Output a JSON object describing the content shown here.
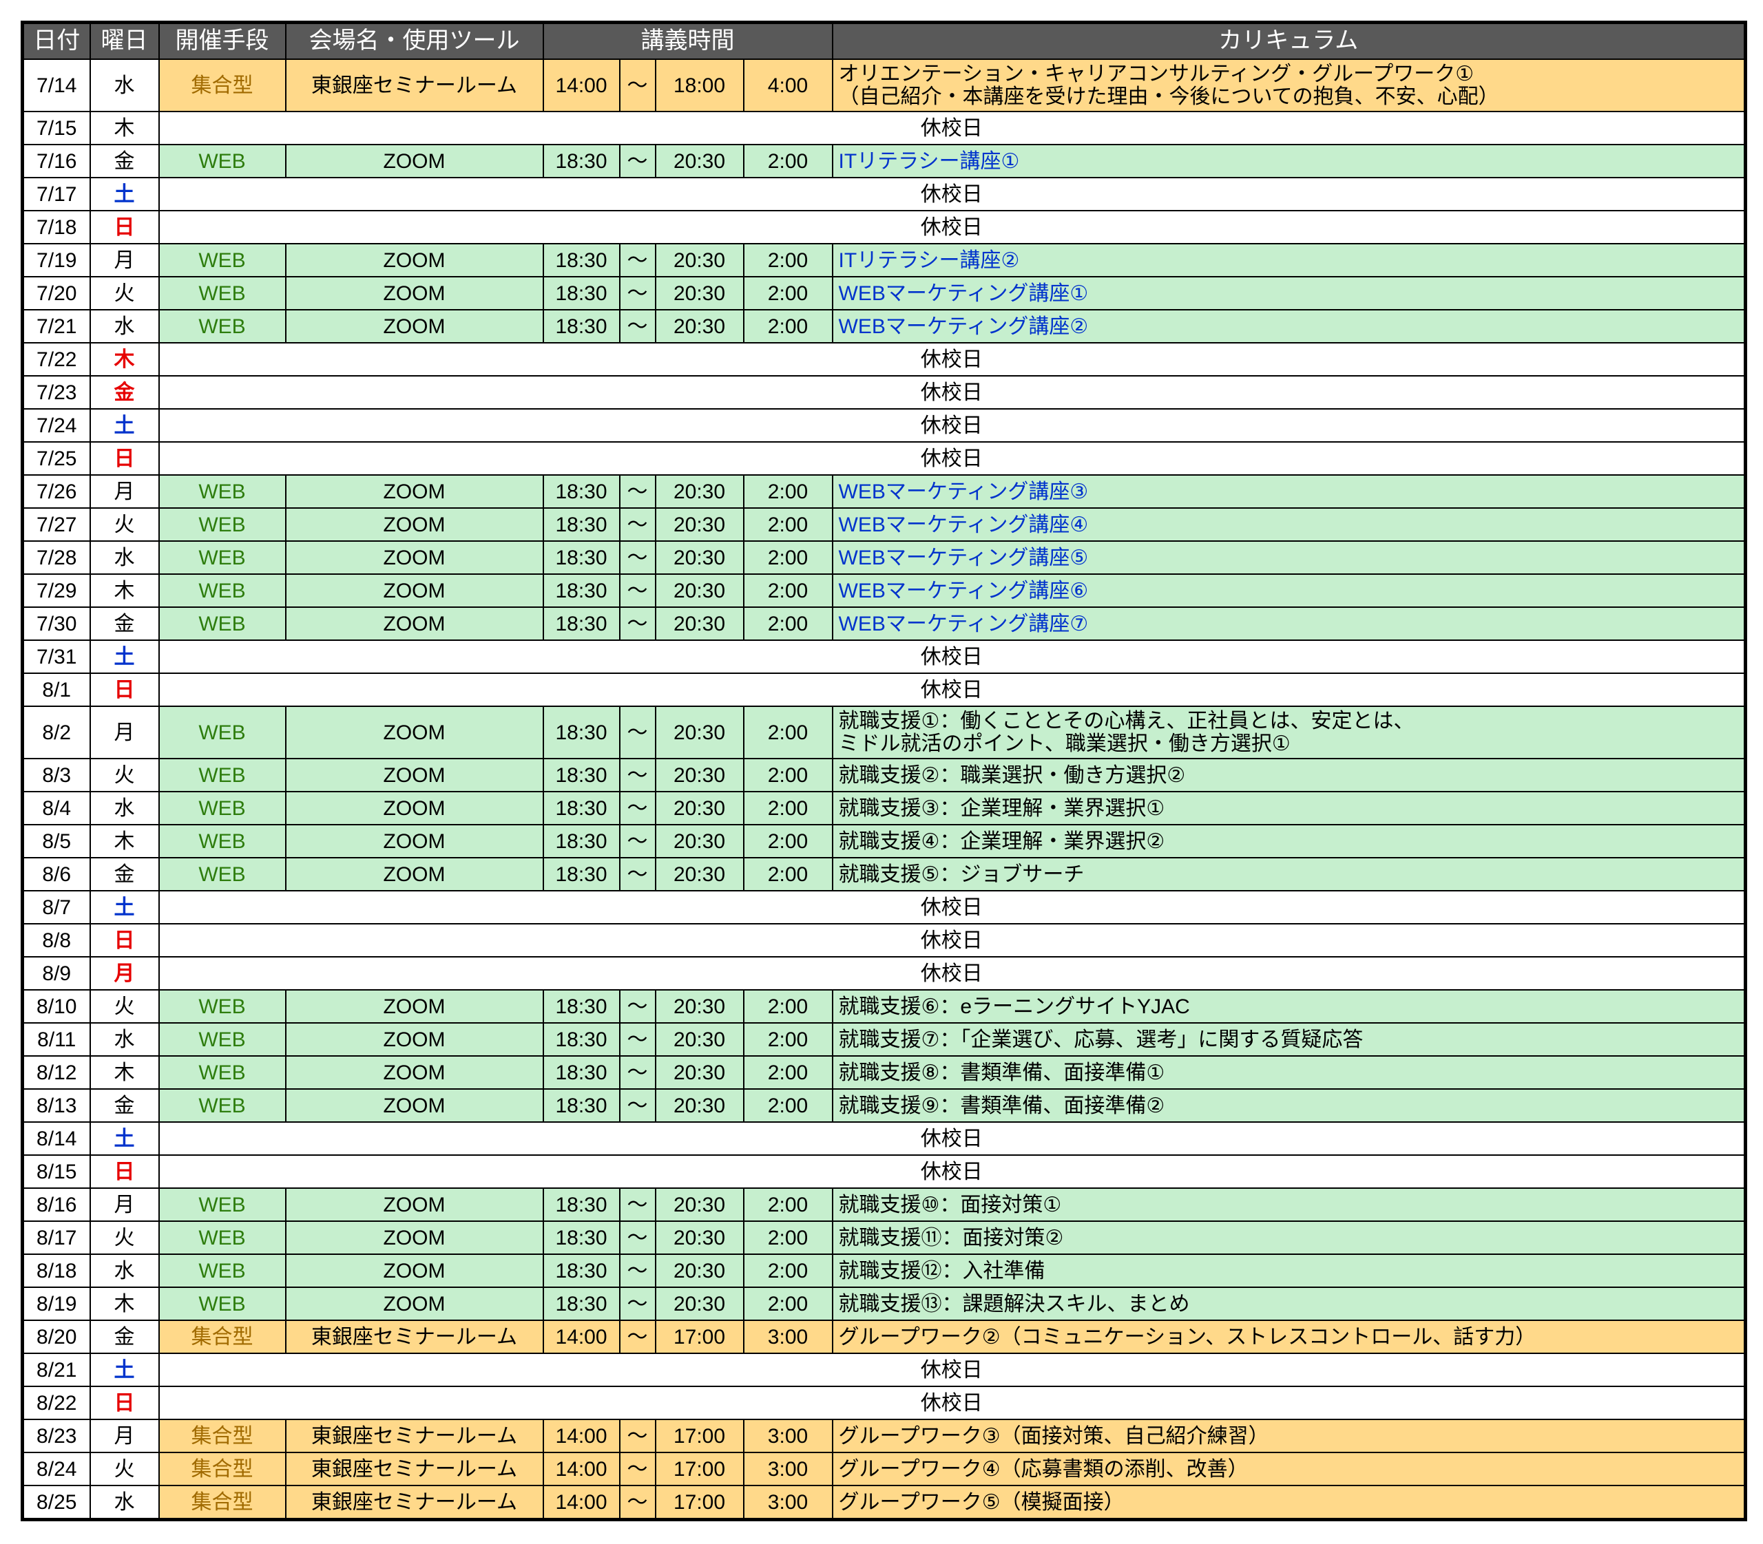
{
  "header": {
    "date": "日付",
    "dow": "曜日",
    "mode": "開催手段",
    "venue": "会場名・使用ツール",
    "time": "講義時間",
    "curriculum": "カリキュラム"
  },
  "colors": {
    "header_bg": "#595959",
    "web_bg": "#c6efce",
    "meet_bg": "#ffd98a",
    "web_text": "#2e7d0e",
    "meet_text": "#a06a00",
    "saturday": "#0033cc",
    "sunday_holiday": "#e60000",
    "it_course_text": "#0033cc"
  },
  "rows": [
    {
      "date": "7/14",
      "dow": "水",
      "day": "wk",
      "type": "meet",
      "mode": "集合型",
      "venue": "東銀座セミナールーム",
      "start": "14:00",
      "tilde": "～",
      "end": "18:00",
      "dur": "4:00",
      "cur": "オリエンテーション・キャリアコンサルティング・グループワーク①",
      "cur2": "（自己紹介・本講座を受けた理由・今後についての抱負、不安、心配）"
    },
    {
      "date": "7/15",
      "dow": "木",
      "day": "wk",
      "type": "holiday",
      "label": "休校日"
    },
    {
      "date": "7/16",
      "dow": "金",
      "day": "wk",
      "type": "web",
      "mode": "WEB",
      "venue": "ZOOM",
      "start": "18:30",
      "tilde": "～",
      "end": "20:30",
      "dur": "2:00",
      "cur": "ITリテラシー講座①",
      "blue": true
    },
    {
      "date": "7/17",
      "dow": "土",
      "day": "sat",
      "type": "holiday",
      "label": "休校日"
    },
    {
      "date": "7/18",
      "dow": "日",
      "day": "sun",
      "type": "holiday",
      "label": "休校日"
    },
    {
      "date": "7/19",
      "dow": "月",
      "day": "wk",
      "type": "web",
      "mode": "WEB",
      "venue": "ZOOM",
      "start": "18:30",
      "tilde": "～",
      "end": "20:30",
      "dur": "2:00",
      "cur": "ITリテラシー講座②",
      "blue": true
    },
    {
      "date": "7/20",
      "dow": "火",
      "day": "wk",
      "type": "web",
      "mode": "WEB",
      "venue": "ZOOM",
      "start": "18:30",
      "tilde": "～",
      "end": "20:30",
      "dur": "2:00",
      "cur": "WEBマーケティング講座①",
      "blue": true
    },
    {
      "date": "7/21",
      "dow": "水",
      "day": "wk",
      "type": "web",
      "mode": "WEB",
      "venue": "ZOOM",
      "start": "18:30",
      "tilde": "～",
      "end": "20:30",
      "dur": "2:00",
      "cur": "WEBマーケティング講座②",
      "blue": true
    },
    {
      "date": "7/22",
      "dow": "木",
      "day": "sun",
      "type": "holiday",
      "label": "休校日"
    },
    {
      "date": "7/23",
      "dow": "金",
      "day": "sun",
      "type": "holiday",
      "label": "休校日"
    },
    {
      "date": "7/24",
      "dow": "土",
      "day": "sat",
      "type": "holiday",
      "label": "休校日"
    },
    {
      "date": "7/25",
      "dow": "日",
      "day": "sun",
      "type": "holiday",
      "label": "休校日"
    },
    {
      "date": "7/26",
      "dow": "月",
      "day": "wk",
      "type": "web",
      "mode": "WEB",
      "venue": "ZOOM",
      "start": "18:30",
      "tilde": "～",
      "end": "20:30",
      "dur": "2:00",
      "cur": "WEBマーケティング講座③",
      "blue": true
    },
    {
      "date": "7/27",
      "dow": "火",
      "day": "wk",
      "type": "web",
      "mode": "WEB",
      "venue": "ZOOM",
      "start": "18:30",
      "tilde": "～",
      "end": "20:30",
      "dur": "2:00",
      "cur": "WEBマーケティング講座④",
      "blue": true
    },
    {
      "date": "7/28",
      "dow": "水",
      "day": "wk",
      "type": "web",
      "mode": "WEB",
      "venue": "ZOOM",
      "start": "18:30",
      "tilde": "～",
      "end": "20:30",
      "dur": "2:00",
      "cur": "WEBマーケティング講座⑤",
      "blue": true
    },
    {
      "date": "7/29",
      "dow": "木",
      "day": "wk",
      "type": "web",
      "mode": "WEB",
      "venue": "ZOOM",
      "start": "18:30",
      "tilde": "～",
      "end": "20:30",
      "dur": "2:00",
      "cur": "WEBマーケティング講座⑥",
      "blue": true
    },
    {
      "date": "7/30",
      "dow": "金",
      "day": "wk",
      "type": "web",
      "mode": "WEB",
      "venue": "ZOOM",
      "start": "18:30",
      "tilde": "～",
      "end": "20:30",
      "dur": "2:00",
      "cur": "WEBマーケティング講座⑦",
      "blue": true
    },
    {
      "date": "7/31",
      "dow": "土",
      "day": "sat",
      "type": "holiday",
      "label": "休校日"
    },
    {
      "date": "8/1",
      "dow": "日",
      "day": "sun",
      "type": "holiday",
      "label": "休校日"
    },
    {
      "date": "8/2",
      "dow": "月",
      "day": "wk",
      "type": "web",
      "mode": "WEB",
      "venue": "ZOOM",
      "start": "18:30",
      "tilde": "～",
      "end": "20:30",
      "dur": "2:00",
      "cur": "就職支援①：働くこととその心構え、正社員とは、安定とは、",
      "cur2": "ミドル就活のポイント、職業選択・働き方選択①"
    },
    {
      "date": "8/3",
      "dow": "火",
      "day": "wk",
      "type": "web",
      "mode": "WEB",
      "venue": "ZOOM",
      "start": "18:30",
      "tilde": "～",
      "end": "20:30",
      "dur": "2:00",
      "cur": "就職支援②：職業選択・働き方選択②"
    },
    {
      "date": "8/4",
      "dow": "水",
      "day": "wk",
      "type": "web",
      "mode": "WEB",
      "venue": "ZOOM",
      "start": "18:30",
      "tilde": "～",
      "end": "20:30",
      "dur": "2:00",
      "cur": "就職支援③：企業理解・業界選択①"
    },
    {
      "date": "8/5",
      "dow": "木",
      "day": "wk",
      "type": "web",
      "mode": "WEB",
      "venue": "ZOOM",
      "start": "18:30",
      "tilde": "～",
      "end": "20:30",
      "dur": "2:00",
      "cur": "就職支援④：企業理解・業界選択②"
    },
    {
      "date": "8/6",
      "dow": "金",
      "day": "wk",
      "type": "web",
      "mode": "WEB",
      "venue": "ZOOM",
      "start": "18:30",
      "tilde": "～",
      "end": "20:30",
      "dur": "2:00",
      "cur": "就職支援⑤：ジョブサーチ"
    },
    {
      "date": "8/7",
      "dow": "土",
      "day": "sat",
      "type": "holiday",
      "label": "休校日"
    },
    {
      "date": "8/8",
      "dow": "日",
      "day": "sun",
      "type": "holiday",
      "label": "休校日"
    },
    {
      "date": "8/9",
      "dow": "月",
      "day": "sun",
      "type": "holiday",
      "label": "休校日"
    },
    {
      "date": "8/10",
      "dow": "火",
      "day": "wk",
      "type": "web",
      "mode": "WEB",
      "venue": "ZOOM",
      "start": "18:30",
      "tilde": "～",
      "end": "20:30",
      "dur": "2:00",
      "cur": "就職支援⑥：eラーニングサイトYJAC"
    },
    {
      "date": "8/11",
      "dow": "水",
      "day": "wk",
      "type": "web",
      "mode": "WEB",
      "venue": "ZOOM",
      "start": "18:30",
      "tilde": "～",
      "end": "20:30",
      "dur": "2:00",
      "cur": "就職支援⑦：「企業選び、応募、選考」に関する質疑応答"
    },
    {
      "date": "8/12",
      "dow": "木",
      "day": "wk",
      "type": "web",
      "mode": "WEB",
      "venue": "ZOOM",
      "start": "18:30",
      "tilde": "～",
      "end": "20:30",
      "dur": "2:00",
      "cur": "就職支援⑧：書類準備、面接準備①"
    },
    {
      "date": "8/13",
      "dow": "金",
      "day": "wk",
      "type": "web",
      "mode": "WEB",
      "venue": "ZOOM",
      "start": "18:30",
      "tilde": "～",
      "end": "20:30",
      "dur": "2:00",
      "cur": "就職支援⑨：書類準備、面接準備②"
    },
    {
      "date": "8/14",
      "dow": "土",
      "day": "sat",
      "type": "holiday",
      "label": "休校日"
    },
    {
      "date": "8/15",
      "dow": "日",
      "day": "sun",
      "type": "holiday",
      "label": "休校日"
    },
    {
      "date": "8/16",
      "dow": "月",
      "day": "wk",
      "type": "web",
      "mode": "WEB",
      "venue": "ZOOM",
      "start": "18:30",
      "tilde": "～",
      "end": "20:30",
      "dur": "2:00",
      "cur": "就職支援⑩：面接対策①"
    },
    {
      "date": "8/17",
      "dow": "火",
      "day": "wk",
      "type": "web",
      "mode": "WEB",
      "venue": "ZOOM",
      "start": "18:30",
      "tilde": "～",
      "end": "20:30",
      "dur": "2:00",
      "cur": "就職支援⑪：面接対策②"
    },
    {
      "date": "8/18",
      "dow": "水",
      "day": "wk",
      "type": "web",
      "mode": "WEB",
      "venue": "ZOOM",
      "start": "18:30",
      "tilde": "～",
      "end": "20:30",
      "dur": "2:00",
      "cur": "就職支援⑫：入社準備"
    },
    {
      "date": "8/19",
      "dow": "木",
      "day": "wk",
      "type": "web",
      "mode": "WEB",
      "venue": "ZOOM",
      "start": "18:30",
      "tilde": "～",
      "end": "20:30",
      "dur": "2:00",
      "cur": "就職支援⑬：課題解決スキル、まとめ"
    },
    {
      "date": "8/20",
      "dow": "金",
      "day": "wk",
      "type": "meet",
      "mode": "集合型",
      "venue": "東銀座セミナールーム",
      "start": "14:00",
      "tilde": "～",
      "end": "17:00",
      "dur": "3:00",
      "cur": "グループワーク②（コミュニケーション、ストレスコントロール、話す力）"
    },
    {
      "date": "8/21",
      "dow": "土",
      "day": "sat",
      "type": "holiday",
      "label": "休校日"
    },
    {
      "date": "8/22",
      "dow": "日",
      "day": "sun",
      "type": "holiday",
      "label": "休校日"
    },
    {
      "date": "8/23",
      "dow": "月",
      "day": "wk",
      "type": "meet",
      "mode": "集合型",
      "venue": "東銀座セミナールーム",
      "start": "14:00",
      "tilde": "～",
      "end": "17:00",
      "dur": "3:00",
      "cur": "グループワーク③（面接対策、自己紹介練習）"
    },
    {
      "date": "8/24",
      "dow": "火",
      "day": "wk",
      "type": "meet",
      "mode": "集合型",
      "venue": "東銀座セミナールーム",
      "start": "14:00",
      "tilde": "～",
      "end": "17:00",
      "dur": "3:00",
      "cur": "グループワーク④（応募書類の添削、改善）"
    },
    {
      "date": "8/25",
      "dow": "水",
      "day": "wk",
      "type": "meet",
      "mode": "集合型",
      "venue": "東銀座セミナールーム",
      "start": "14:00",
      "tilde": "～",
      "end": "17:00",
      "dur": "3:00",
      "cur": "グループワーク⑤（模擬面接）"
    }
  ]
}
